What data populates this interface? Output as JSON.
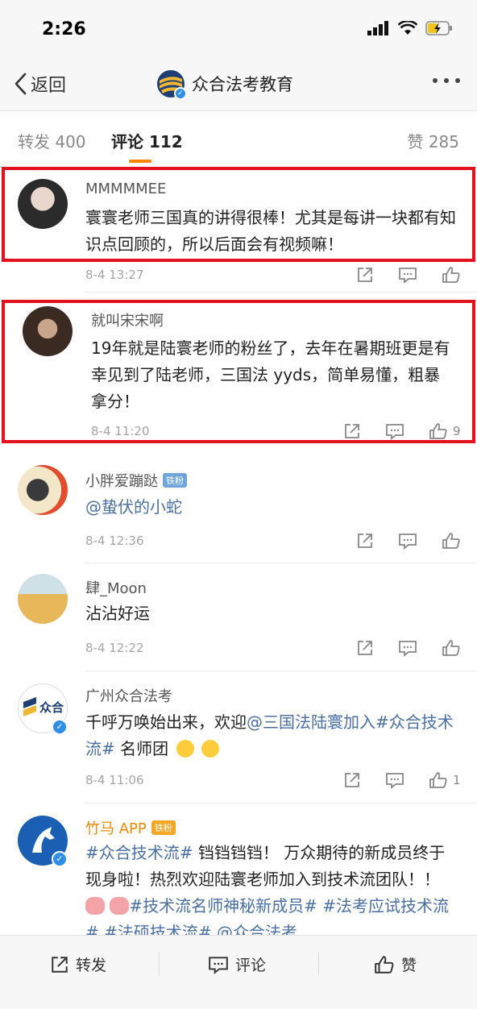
{
  "status_bar": {
    "time": "2:26"
  },
  "nav": {
    "back_label": "返回",
    "title": "众合法考教育"
  },
  "tabs": {
    "repost": "转发 400",
    "comments": "评论 112",
    "likes": "赞 285"
  },
  "comments": [
    {
      "username": "MMMMMEE",
      "text": "寰寰老师三国真的讲得很棒！尤其是每讲一块都有知识点回顾的，所以后面会有视频嘛！",
      "time": "8-4 13:27",
      "likes": ""
    },
    {
      "username": "就叫宋宋啊",
      "text": "19年就是陆寰老师的粉丝了，去年在暑期班更是有幸见到了陆老师，三国法 yyds，简单易懂，粗暴拿分！",
      "time": "8-4 11:20",
      "likes": "9"
    },
    {
      "username": "小胖爱蹦跶",
      "badge": "铁粉",
      "mention": "@蛰伏的小蛇",
      "time": "8-4 12:36",
      "likes": ""
    },
    {
      "username": "肆_Moon",
      "text": "沾沾好运",
      "time": "8-4 12:22",
      "likes": ""
    },
    {
      "username": "广州众合法考",
      "text_prefix": "千呼万唤始出来，欢迎",
      "mention": "@三国法陆寰加入#众合技术流#",
      "text_suffix": " 名师团",
      "avatar_text": "众合",
      "time": "8-4 11:06",
      "likes": "1"
    },
    {
      "username": "竹马 APP",
      "badge": "铁粉",
      "tag1": "#众合技术流#",
      "text_a": " 铛铛铛铛！ 万众期待的新成员终于现身啦！热烈欢迎陆寰老师加入到技术流团队！！",
      "tag2": "#技术流名师神秘新成员#",
      "tag3": "#法考应试技术流#",
      "tag4": "#法硕技术流#",
      "tag5": "@众合法考"
    }
  ],
  "bottom_bar": {
    "repost": "转发",
    "comment": "评论",
    "like": "赞"
  },
  "colors": {
    "accent": "#ff8200",
    "highlight_box": "#e3101d",
    "link": "#4a6fa5"
  }
}
